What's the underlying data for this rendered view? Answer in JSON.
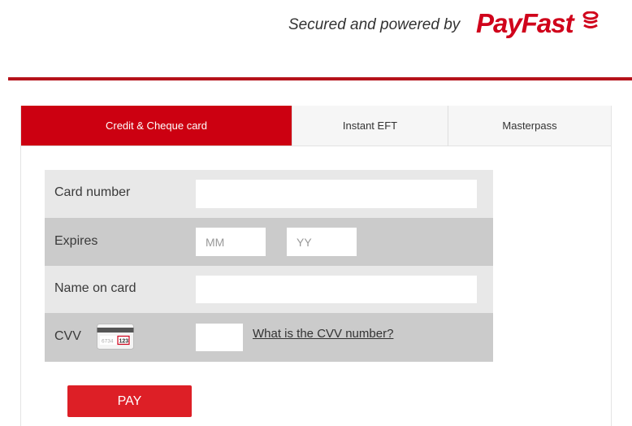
{
  "header": {
    "secured_text": "Secured and powered by",
    "brand_name": "PayFast",
    "brand_icon": "coin-stack-icon"
  },
  "colors": {
    "brand_red": "#d0021b",
    "active_tab": "#cc0011",
    "pay_button": "#dd1f26",
    "row_light": "#e8e8e8",
    "row_dark": "#cbcbcb"
  },
  "tabs": [
    {
      "label": "Credit & Cheque card",
      "active": true
    },
    {
      "label": "Instant EFT",
      "active": false
    },
    {
      "label": "Masterpass",
      "active": false
    }
  ],
  "form": {
    "card_number": {
      "label": "Card number",
      "value": "",
      "placeholder": ""
    },
    "expires": {
      "label": "Expires",
      "month": {
        "value": "",
        "placeholder": "MM"
      },
      "year": {
        "value": "",
        "placeholder": "YY"
      }
    },
    "name_on_card": {
      "label": "Name on card",
      "value": "",
      "placeholder": ""
    },
    "cvv": {
      "label": "CVV",
      "card_icon": "cvv-card-icon",
      "card_digits": "6734",
      "card_code": "123",
      "value": "",
      "help_link": "What is the CVV number?"
    }
  },
  "pay_button": {
    "label": "PAY"
  }
}
